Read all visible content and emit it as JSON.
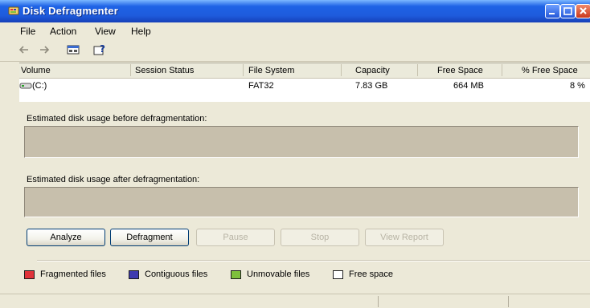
{
  "window": {
    "title": "Disk Defragmenter"
  },
  "menu": [
    {
      "label": "File"
    },
    {
      "label": "Action"
    },
    {
      "label": "View"
    },
    {
      "label": "Help"
    }
  ],
  "toolbar": {
    "back_icon": "back-arrow-icon",
    "forward_icon": "forward-arrow-icon",
    "properties_icon": "properties-icon",
    "help_icon": "help-icon"
  },
  "volumes": {
    "columns": [
      "Volume",
      "Session Status",
      "File System",
      "Capacity",
      "Free Space",
      "% Free Space"
    ],
    "rows": [
      {
        "volume": "(C:)",
        "session_status": "",
        "file_system": "FAT32",
        "capacity": "7.83 GB",
        "free_space": "664 MB",
        "percent_free": "8 %"
      }
    ]
  },
  "analysis": {
    "before_label": "Estimated disk usage before defragmentation:",
    "after_label": "Estimated disk usage after defragmentation:"
  },
  "buttons": {
    "analyze": "Analyze",
    "defragment": "Defragment",
    "pause": "Pause",
    "stop": "Stop",
    "view_report": "View Report"
  },
  "legend": [
    {
      "label": "Fragmented files",
      "color": "#e0323a"
    },
    {
      "label": "Contiguous files",
      "color": "#3f3bb0"
    },
    {
      "label": "Unmovable files",
      "color": "#7ec03c"
    },
    {
      "label": "Free space",
      "color": "#ffffff"
    }
  ],
  "colors": {
    "titlebar": "#1e5bdc",
    "usage_bar": "#c7bfac"
  }
}
